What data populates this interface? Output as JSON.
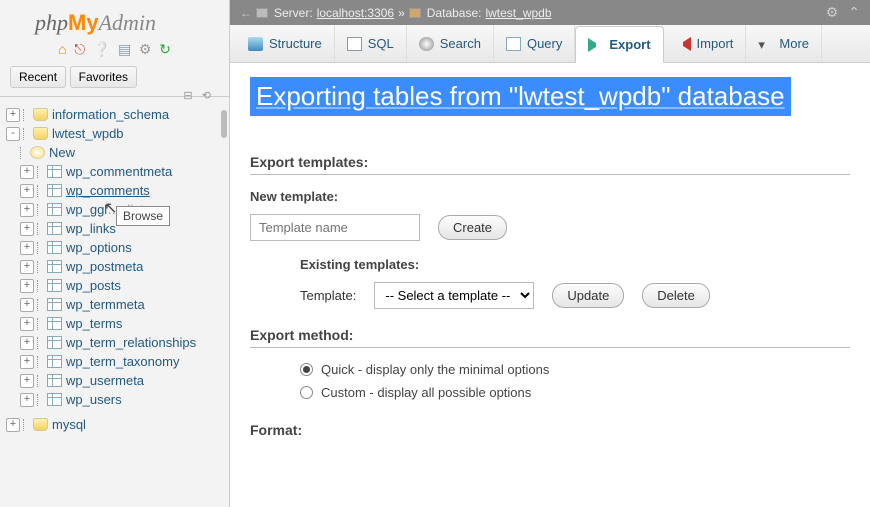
{
  "logo": {
    "php": "php",
    "my": "My",
    "admin": "Admin"
  },
  "sidebar": {
    "recent": "Recent",
    "favorites": "Favorites",
    "tooltip": "Browse",
    "nodes": [
      {
        "type": "db",
        "label": "information_schema",
        "exp": "+"
      },
      {
        "type": "db",
        "label": "lwtest_wpdb",
        "exp": "-",
        "open": true
      },
      {
        "type": "new",
        "label": "New"
      },
      {
        "type": "tbl",
        "label": "wp_commentmeta"
      },
      {
        "type": "tbl",
        "label": "wp_comments",
        "hovered": true
      },
      {
        "type": "tbl",
        "label": "wp_gglcptch_whitelist",
        "truncated": "wp_ggl"
      },
      {
        "type": "tbl",
        "label": "wp_links"
      },
      {
        "type": "tbl",
        "label": "wp_options"
      },
      {
        "type": "tbl",
        "label": "wp_postmeta"
      },
      {
        "type": "tbl",
        "label": "wp_posts"
      },
      {
        "type": "tbl",
        "label": "wp_termmeta"
      },
      {
        "type": "tbl",
        "label": "wp_terms"
      },
      {
        "type": "tbl",
        "label": "wp_term_relationships"
      },
      {
        "type": "tbl",
        "label": "wp_term_taxonomy"
      },
      {
        "type": "tbl",
        "label": "wp_usermeta"
      },
      {
        "type": "tbl",
        "label": "wp_users"
      },
      {
        "type": "db",
        "label": "mysql",
        "exp": "+"
      }
    ]
  },
  "breadcrumb": {
    "server_label": "Server:",
    "server_value": "localhost:3306",
    "sep": "»",
    "db_label": "Database:",
    "db_value": "lwtest_wpdb"
  },
  "tabs": [
    {
      "label": "Structure",
      "icon": "ti-structure"
    },
    {
      "label": "SQL",
      "icon": "ti-sql"
    },
    {
      "label": "Search",
      "icon": "ti-search"
    },
    {
      "label": "Query",
      "icon": "ti-query"
    },
    {
      "label": "Export",
      "icon": "ti-export",
      "active": true
    },
    {
      "label": "Import",
      "icon": "ti-import"
    },
    {
      "label": "More",
      "icon": "ti-more"
    }
  ],
  "page": {
    "title": "Exporting tables from \"lwtest_wpdb\" database",
    "export_templates": "Export templates:",
    "new_template": "New template:",
    "template_placeholder": "Template name",
    "create": "Create",
    "existing_templates": "Existing templates:",
    "template_label": "Template:",
    "template_select": "-- Select a template --",
    "update": "Update",
    "delete": "Delete",
    "export_method": "Export method:",
    "quick": "Quick - display only the minimal options",
    "custom": "Custom - display all possible options",
    "format": "Format:"
  }
}
